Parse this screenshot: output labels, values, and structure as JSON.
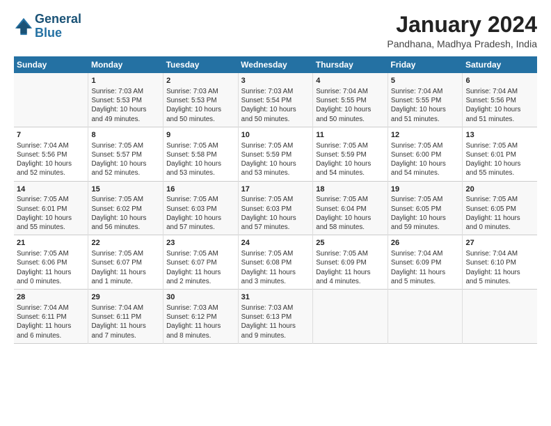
{
  "logo": {
    "line1": "General",
    "line2": "Blue"
  },
  "title": "January 2024",
  "subtitle": "Pandhana, Madhya Pradesh, India",
  "header_days": [
    "Sunday",
    "Monday",
    "Tuesday",
    "Wednesday",
    "Thursday",
    "Friday",
    "Saturday"
  ],
  "weeks": [
    [
      {
        "day": "",
        "lines": []
      },
      {
        "day": "1",
        "lines": [
          "Sunrise: 7:03 AM",
          "Sunset: 5:53 PM",
          "Daylight: 10 hours",
          "and 49 minutes."
        ]
      },
      {
        "day": "2",
        "lines": [
          "Sunrise: 7:03 AM",
          "Sunset: 5:53 PM",
          "Daylight: 10 hours",
          "and 50 minutes."
        ]
      },
      {
        "day": "3",
        "lines": [
          "Sunrise: 7:03 AM",
          "Sunset: 5:54 PM",
          "Daylight: 10 hours",
          "and 50 minutes."
        ]
      },
      {
        "day": "4",
        "lines": [
          "Sunrise: 7:04 AM",
          "Sunset: 5:55 PM",
          "Daylight: 10 hours",
          "and 50 minutes."
        ]
      },
      {
        "day": "5",
        "lines": [
          "Sunrise: 7:04 AM",
          "Sunset: 5:55 PM",
          "Daylight: 10 hours",
          "and 51 minutes."
        ]
      },
      {
        "day": "6",
        "lines": [
          "Sunrise: 7:04 AM",
          "Sunset: 5:56 PM",
          "Daylight: 10 hours",
          "and 51 minutes."
        ]
      }
    ],
    [
      {
        "day": "7",
        "lines": [
          "Sunrise: 7:04 AM",
          "Sunset: 5:56 PM",
          "Daylight: 10 hours",
          "and 52 minutes."
        ]
      },
      {
        "day": "8",
        "lines": [
          "Sunrise: 7:05 AM",
          "Sunset: 5:57 PM",
          "Daylight: 10 hours",
          "and 52 minutes."
        ]
      },
      {
        "day": "9",
        "lines": [
          "Sunrise: 7:05 AM",
          "Sunset: 5:58 PM",
          "Daylight: 10 hours",
          "and 53 minutes."
        ]
      },
      {
        "day": "10",
        "lines": [
          "Sunrise: 7:05 AM",
          "Sunset: 5:59 PM",
          "Daylight: 10 hours",
          "and 53 minutes."
        ]
      },
      {
        "day": "11",
        "lines": [
          "Sunrise: 7:05 AM",
          "Sunset: 5:59 PM",
          "Daylight: 10 hours",
          "and 54 minutes."
        ]
      },
      {
        "day": "12",
        "lines": [
          "Sunrise: 7:05 AM",
          "Sunset: 6:00 PM",
          "Daylight: 10 hours",
          "and 54 minutes."
        ]
      },
      {
        "day": "13",
        "lines": [
          "Sunrise: 7:05 AM",
          "Sunset: 6:01 PM",
          "Daylight: 10 hours",
          "and 55 minutes."
        ]
      }
    ],
    [
      {
        "day": "14",
        "lines": [
          "Sunrise: 7:05 AM",
          "Sunset: 6:01 PM",
          "Daylight: 10 hours",
          "and 55 minutes."
        ]
      },
      {
        "day": "15",
        "lines": [
          "Sunrise: 7:05 AM",
          "Sunset: 6:02 PM",
          "Daylight: 10 hours",
          "and 56 minutes."
        ]
      },
      {
        "day": "16",
        "lines": [
          "Sunrise: 7:05 AM",
          "Sunset: 6:03 PM",
          "Daylight: 10 hours",
          "and 57 minutes."
        ]
      },
      {
        "day": "17",
        "lines": [
          "Sunrise: 7:05 AM",
          "Sunset: 6:03 PM",
          "Daylight: 10 hours",
          "and 57 minutes."
        ]
      },
      {
        "day": "18",
        "lines": [
          "Sunrise: 7:05 AM",
          "Sunset: 6:04 PM",
          "Daylight: 10 hours",
          "and 58 minutes."
        ]
      },
      {
        "day": "19",
        "lines": [
          "Sunrise: 7:05 AM",
          "Sunset: 6:05 PM",
          "Daylight: 10 hours",
          "and 59 minutes."
        ]
      },
      {
        "day": "20",
        "lines": [
          "Sunrise: 7:05 AM",
          "Sunset: 6:05 PM",
          "Daylight: 11 hours",
          "and 0 minutes."
        ]
      }
    ],
    [
      {
        "day": "21",
        "lines": [
          "Sunrise: 7:05 AM",
          "Sunset: 6:06 PM",
          "Daylight: 11 hours",
          "and 0 minutes."
        ]
      },
      {
        "day": "22",
        "lines": [
          "Sunrise: 7:05 AM",
          "Sunset: 6:07 PM",
          "Daylight: 11 hours",
          "and 1 minute."
        ]
      },
      {
        "day": "23",
        "lines": [
          "Sunrise: 7:05 AM",
          "Sunset: 6:07 PM",
          "Daylight: 11 hours",
          "and 2 minutes."
        ]
      },
      {
        "day": "24",
        "lines": [
          "Sunrise: 7:05 AM",
          "Sunset: 6:08 PM",
          "Daylight: 11 hours",
          "and 3 minutes."
        ]
      },
      {
        "day": "25",
        "lines": [
          "Sunrise: 7:05 AM",
          "Sunset: 6:09 PM",
          "Daylight: 11 hours",
          "and 4 minutes."
        ]
      },
      {
        "day": "26",
        "lines": [
          "Sunrise: 7:04 AM",
          "Sunset: 6:09 PM",
          "Daylight: 11 hours",
          "and 5 minutes."
        ]
      },
      {
        "day": "27",
        "lines": [
          "Sunrise: 7:04 AM",
          "Sunset: 6:10 PM",
          "Daylight: 11 hours",
          "and 5 minutes."
        ]
      }
    ],
    [
      {
        "day": "28",
        "lines": [
          "Sunrise: 7:04 AM",
          "Sunset: 6:11 PM",
          "Daylight: 11 hours",
          "and 6 minutes."
        ]
      },
      {
        "day": "29",
        "lines": [
          "Sunrise: 7:04 AM",
          "Sunset: 6:11 PM",
          "Daylight: 11 hours",
          "and 7 minutes."
        ]
      },
      {
        "day": "30",
        "lines": [
          "Sunrise: 7:03 AM",
          "Sunset: 6:12 PM",
          "Daylight: 11 hours",
          "and 8 minutes."
        ]
      },
      {
        "day": "31",
        "lines": [
          "Sunrise: 7:03 AM",
          "Sunset: 6:13 PM",
          "Daylight: 11 hours",
          "and 9 minutes."
        ]
      },
      {
        "day": "",
        "lines": []
      },
      {
        "day": "",
        "lines": []
      },
      {
        "day": "",
        "lines": []
      }
    ]
  ]
}
